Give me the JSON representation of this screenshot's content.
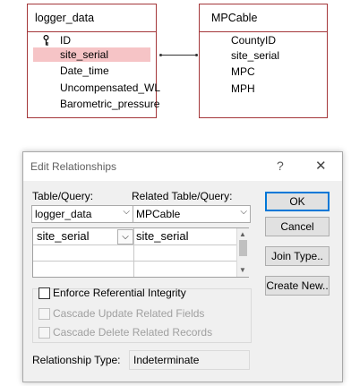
{
  "left_table": {
    "title": "logger_data",
    "fields": [
      "ID",
      "site_serial",
      "Date_time",
      "Uncompensated_WL",
      "Barometric_pressure"
    ]
  },
  "right_table": {
    "title": "MPCable",
    "fields": [
      "CountyID",
      "site_serial",
      "MPC",
      "MPH"
    ]
  },
  "dialog": {
    "title": "Edit Relationships",
    "help": "?",
    "close": "✕",
    "table_query_label": "Table/Query:",
    "related_label": "Related Table/Query:",
    "table_value": "logger_data",
    "related_value": "MPCable",
    "grid_left": "site_serial",
    "grid_right": "site_serial",
    "buttons": {
      "ok": "OK",
      "cancel": "Cancel",
      "join": "Join Type..",
      "create": "Create New.."
    },
    "enforce": "Enforce Referential Integrity",
    "cascade_update": "Cascade Update Related Fields",
    "cascade_delete": "Cascade Delete Related Records",
    "rel_type_label": "Relationship Type:",
    "rel_type_value": "Indeterminate"
  }
}
